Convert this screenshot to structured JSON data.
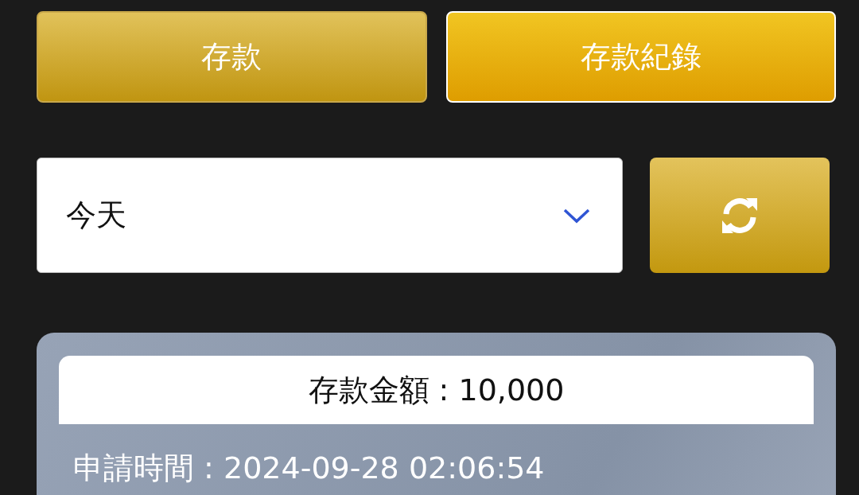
{
  "tabs": [
    {
      "label": "存款",
      "selected": false
    },
    {
      "label": "存款紀錄",
      "selected": true
    }
  ],
  "filter": {
    "value": "今天"
  },
  "records": [
    {
      "amount_label": "存款金額 : 10,000",
      "time_label": "申請時間 : 2024-09-28 02:06:54"
    }
  ]
}
